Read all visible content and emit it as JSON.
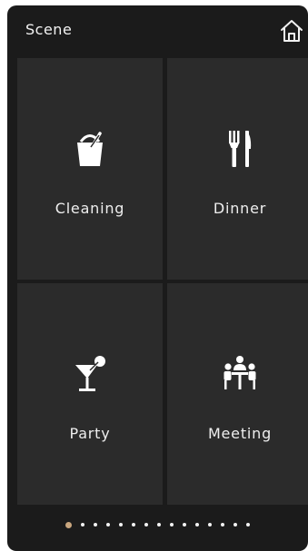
{
  "header": {
    "title": "Scene",
    "home_icon": "home-icon"
  },
  "scenes": [
    {
      "label": "Cleaning",
      "icon": "bucket-icon"
    },
    {
      "label": "Dinner",
      "icon": "fork-knife-icon"
    },
    {
      "label": "Party",
      "icon": "cocktail-icon"
    },
    {
      "label": "Meeting",
      "icon": "meeting-icon"
    }
  ],
  "pager": {
    "total_pages": 15,
    "current_page": 1
  },
  "colors": {
    "background": "#1b1b1b",
    "tile": "#2b2b2b",
    "text": "#eeeeee",
    "active_dot": "#c9a67e"
  }
}
